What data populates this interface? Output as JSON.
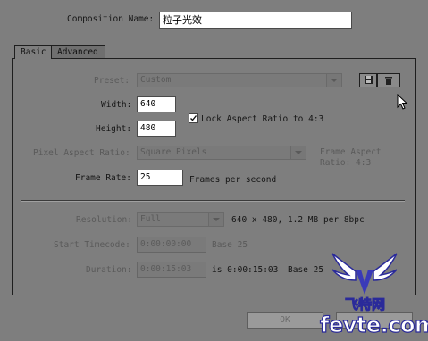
{
  "composition": {
    "name_label": "Composition Name:",
    "name_value": "粒子光效"
  },
  "tabs": [
    {
      "label": "Basic"
    },
    {
      "label": "Advanced"
    }
  ],
  "preset": {
    "label": "Preset:",
    "value": "Custom"
  },
  "width": {
    "label": "Width:",
    "value": "640"
  },
  "height": {
    "label": "Height:",
    "value": "480"
  },
  "lock_aspect": {
    "label": "Lock Aspect Ratio to 4:3",
    "checked": true
  },
  "pixel_aspect": {
    "label": "Pixel Aspect Ratio:",
    "value": "Square Pixels",
    "frame_aspect_line1": "Frame Aspect",
    "frame_aspect_line2": "Ratio: 4:3"
  },
  "frame_rate": {
    "label": "Frame Rate:",
    "value": "25",
    "unit": "Frames per second"
  },
  "resolution": {
    "label": "Resolution:",
    "value": "Full",
    "info": "640 x 480, 1.2 MB per 8bpc"
  },
  "start_timecode": {
    "label": "Start Timecode:",
    "value": "0:00:00:00",
    "base": "Base 25"
  },
  "duration": {
    "label": "Duration:",
    "value": "0:00:15:03",
    "info": "is 0:00:15:03",
    "base": "Base 25"
  },
  "buttons": {
    "ok": "OK"
  },
  "watermark": {
    "site": "fevte.com",
    "cn": "飞特网"
  }
}
